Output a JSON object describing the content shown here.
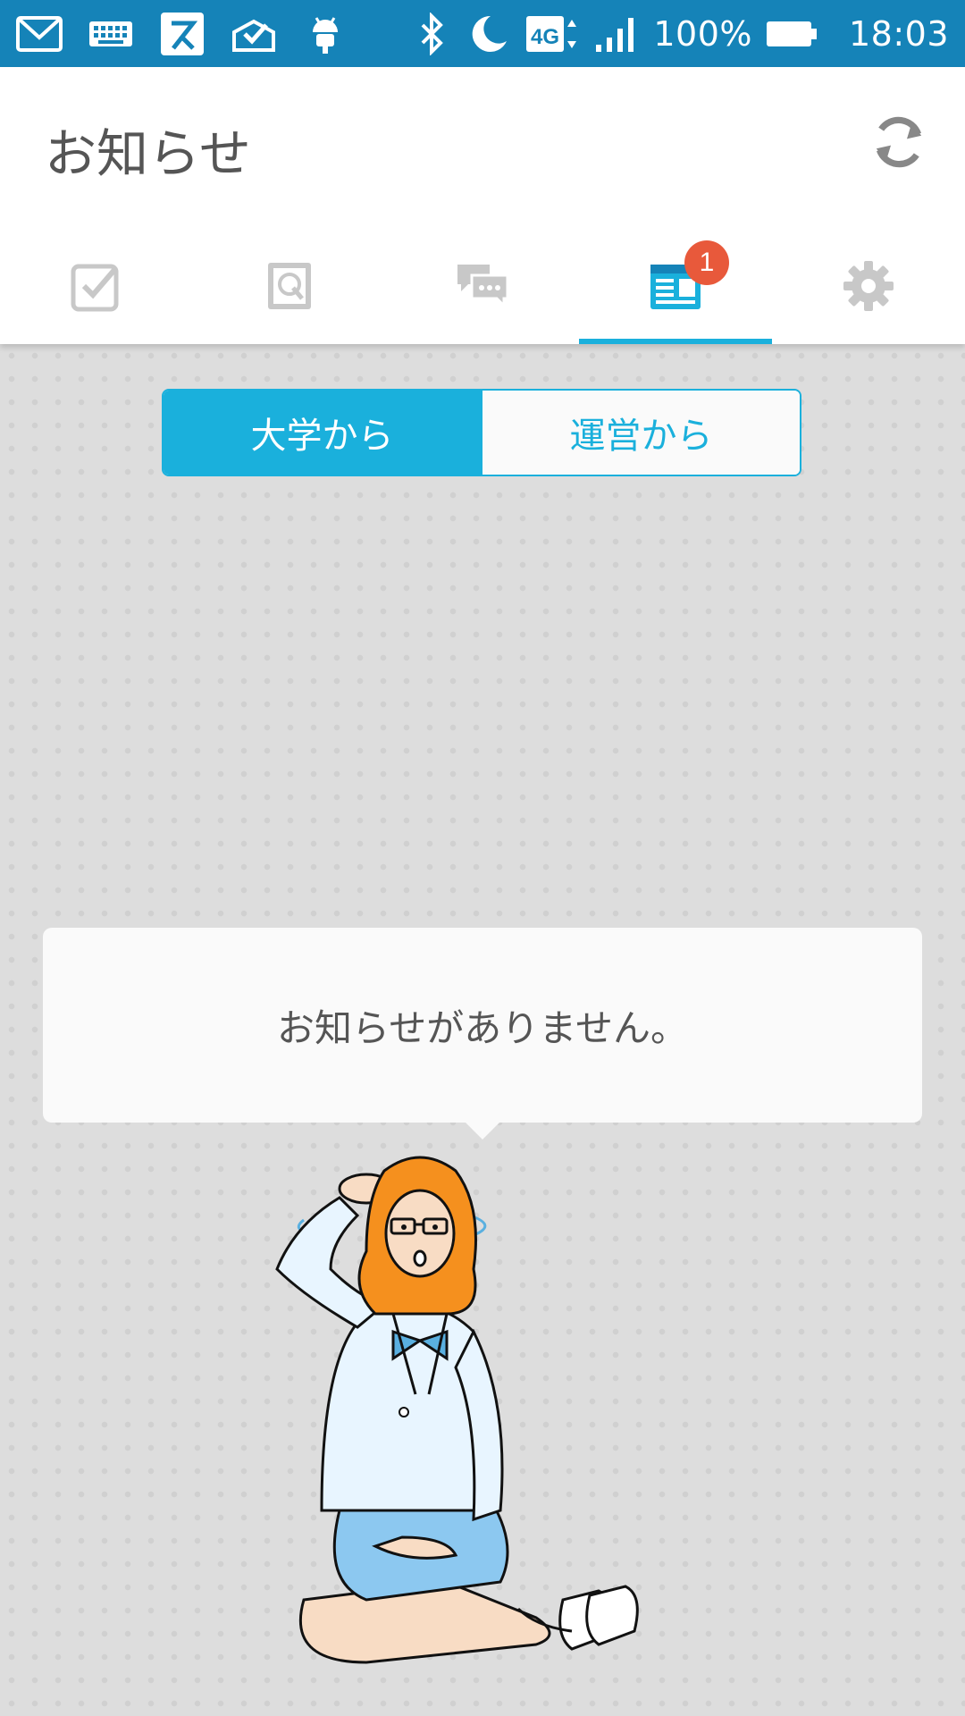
{
  "status_bar": {
    "left_icons": [
      "gmail-icon",
      "keyboard-icon",
      "app-su-icon",
      "task-check-icon",
      "android-icon"
    ],
    "right_icons": [
      "bluetooth-icon",
      "moon-icon",
      "network-4g-icon",
      "signal-icon"
    ],
    "network": "4G",
    "battery": "100%",
    "time": "18:03"
  },
  "appbar": {
    "title": "お知らせ",
    "refresh_icon": "refresh-icon"
  },
  "tabs": [
    {
      "name": "tasks",
      "icon": "checkbox-icon",
      "active": false
    },
    {
      "name": "notebook",
      "icon": "notebook-icon",
      "active": false
    },
    {
      "name": "messages",
      "icon": "chat-icon",
      "active": false
    },
    {
      "name": "news",
      "icon": "news-icon",
      "active": true,
      "badge": "1"
    },
    {
      "name": "settings",
      "icon": "gear-icon",
      "active": false
    }
  ],
  "segment": {
    "university_label": "大学から",
    "operator_label": "運営から",
    "selected": "大学から"
  },
  "empty_message": "お知らせがありません。",
  "colors": {
    "status_bar": "#1583b8",
    "accent": "#1ab0dc",
    "badge": "#e8593b",
    "tab_inactive": "#c8c8c8"
  }
}
